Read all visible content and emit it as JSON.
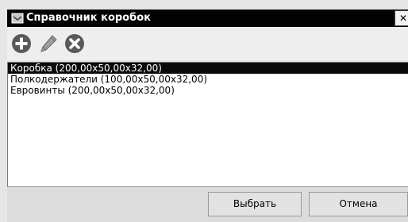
{
  "window": {
    "title": "Справочник коробок",
    "close_label": "✕"
  },
  "toolbar": {
    "buttons": [
      {
        "name": "add",
        "icon": "plus-circle-icon"
      },
      {
        "name": "edit",
        "icon": "pencil-icon"
      },
      {
        "name": "delete",
        "icon": "x-circle-icon"
      }
    ]
  },
  "list": {
    "items": [
      {
        "label": "Коробка (200,00x50,00x32,00)",
        "selected": true
      },
      {
        "label": "Полкодержатели (100,00x50,00x32,00)",
        "selected": false
      },
      {
        "label": "Евровинты (200,00x50,00x32,00)",
        "selected": false
      }
    ]
  },
  "footer": {
    "select_label": "Выбрать",
    "cancel_label": "Отмена"
  },
  "colors": {
    "titlebar": "#030303",
    "selection": "#0a0a0a",
    "icon": "#5a5a5a",
    "background": "#e6e6e6"
  }
}
